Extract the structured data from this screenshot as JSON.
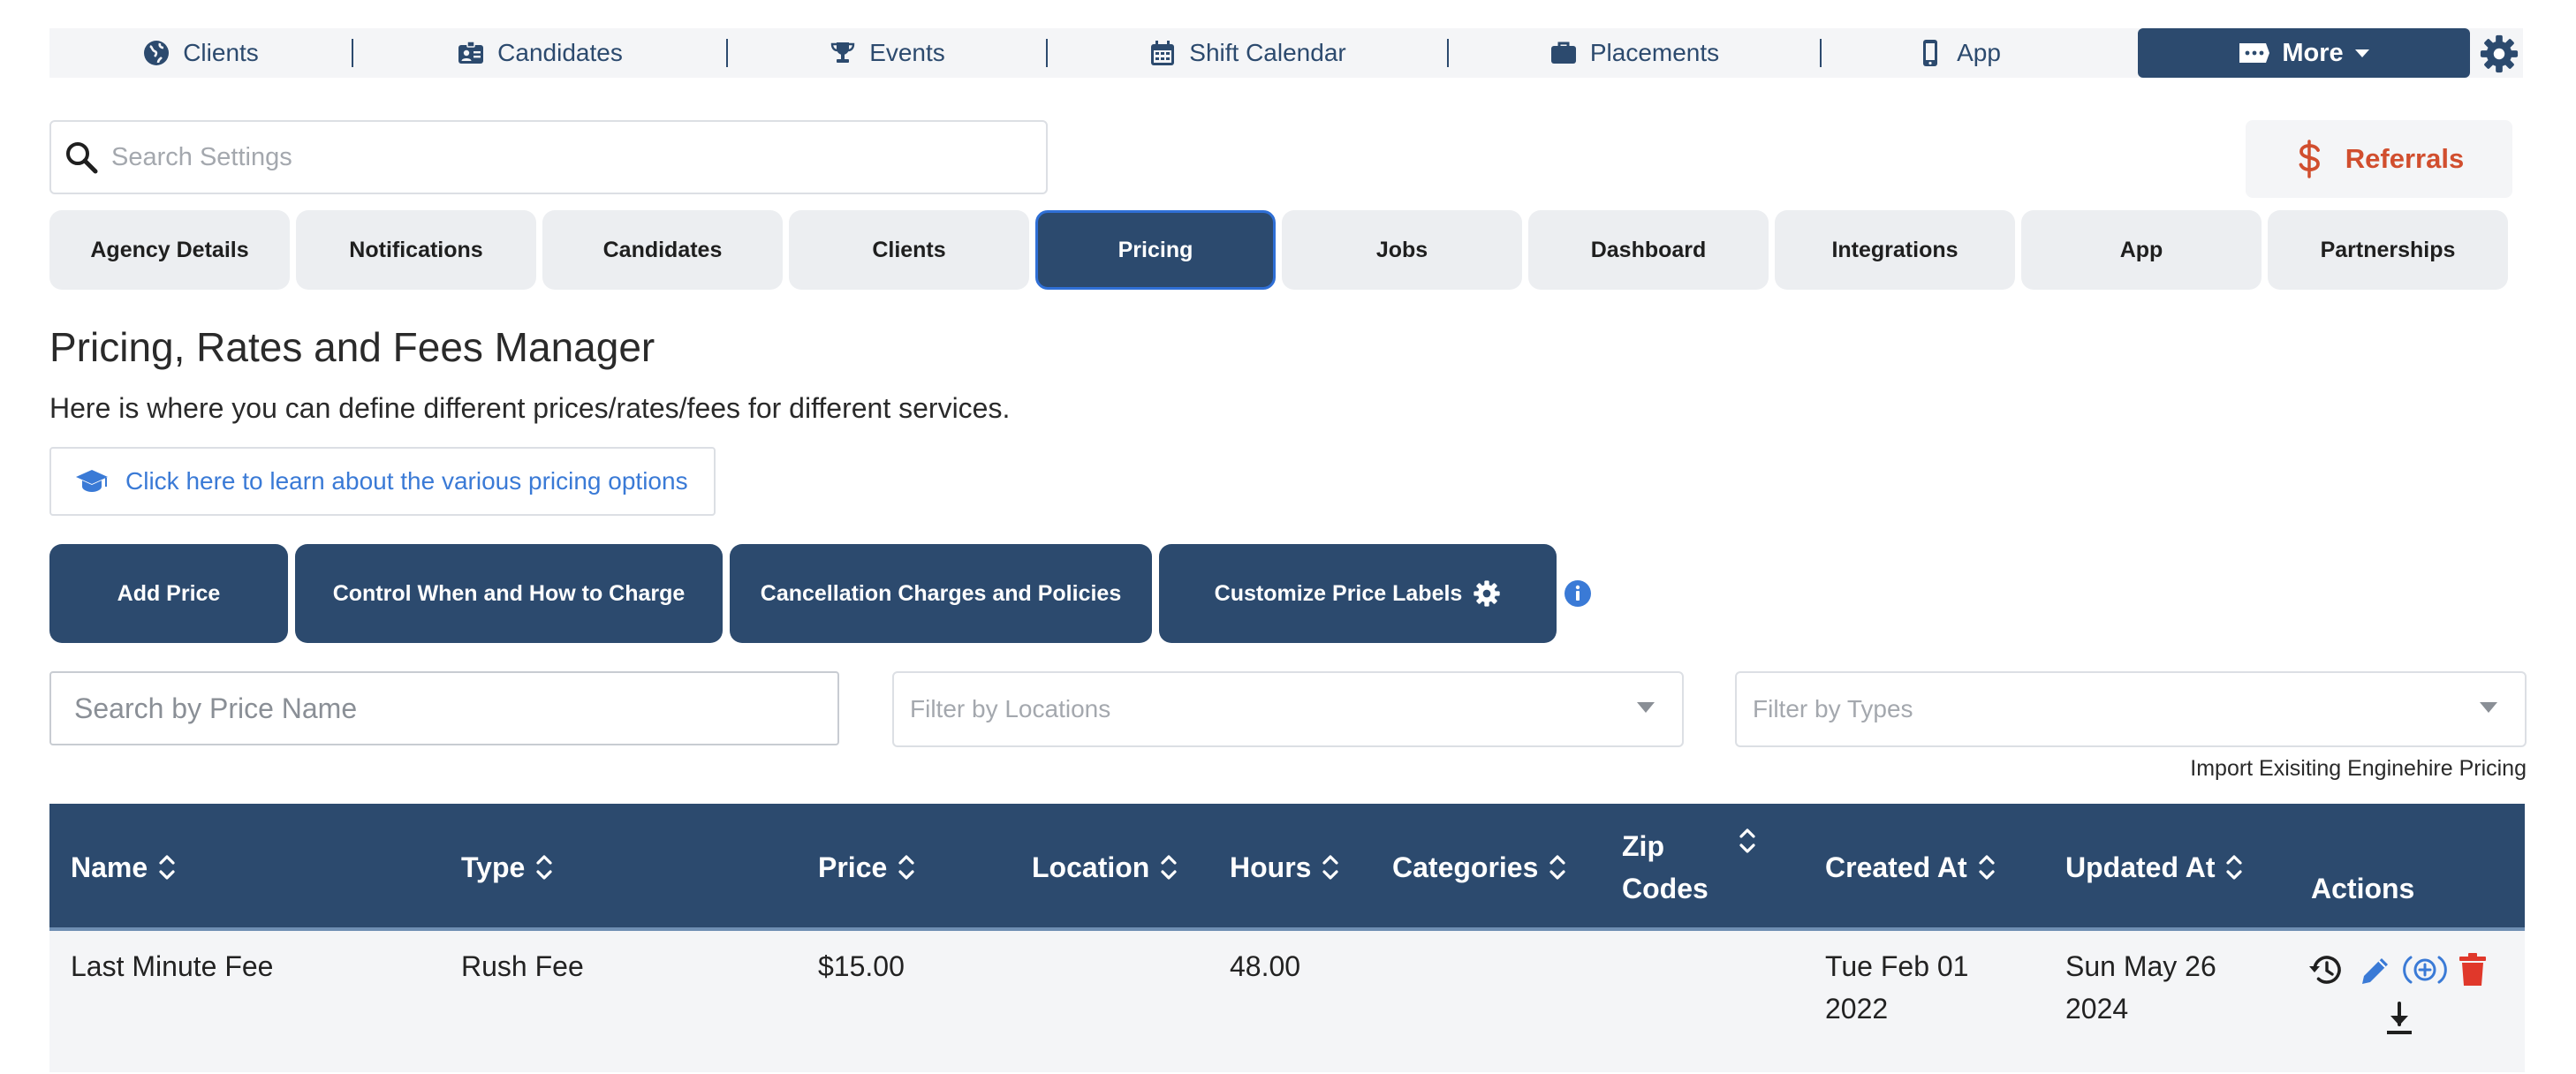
{
  "topnav": {
    "items": [
      {
        "label": "Clients",
        "icon": "globe-icon"
      },
      {
        "label": "Candidates",
        "icon": "id-card-icon"
      },
      {
        "label": "Events",
        "icon": "trophy-icon"
      },
      {
        "label": "Shift Calendar",
        "icon": "calendar-icon"
      },
      {
        "label": "Placements",
        "icon": "briefcase-icon"
      },
      {
        "label": "App",
        "icon": "mobile-icon"
      }
    ],
    "more_label": "More"
  },
  "settings_search": {
    "placeholder": "Search Settings"
  },
  "referrals": {
    "label": "Referrals"
  },
  "tabs": [
    {
      "label": "Agency Details"
    },
    {
      "label": "Notifications"
    },
    {
      "label": "Candidates"
    },
    {
      "label": "Clients"
    },
    {
      "label": "Pricing"
    },
    {
      "label": "Jobs"
    },
    {
      "label": "Dashboard"
    },
    {
      "label": "Integrations"
    },
    {
      "label": "App"
    },
    {
      "label": "Partnerships"
    }
  ],
  "active_tab": "Pricing",
  "page": {
    "title": "Pricing, Rates and Fees Manager",
    "subtitle": "Here is where you can define different prices/rates/fees for different services.",
    "learn_link": "Click here to learn about the various pricing options"
  },
  "actions": {
    "add_price": "Add Price",
    "control_charge": "Control When and How to Charge",
    "cancellation": "Cancellation Charges and Policies",
    "customize_labels": "Customize Price Labels"
  },
  "filters": {
    "price_search_placeholder": "Search by Price Name",
    "locations_placeholder": "Filter by Locations",
    "types_placeholder": "Filter by Types",
    "import_link": "Import Exisiting Enginehire Pricing"
  },
  "table": {
    "columns": {
      "name": "Name",
      "type": "Type",
      "price": "Price",
      "location": "Location",
      "hours": "Hours",
      "categories": "Categories",
      "zip_line1": "Zip",
      "zip_line2": "Codes",
      "created_at": "Created At",
      "updated_at": "Updated At",
      "actions": "Actions"
    },
    "rows": [
      {
        "name": "Last Minute Fee",
        "type": "Rush Fee",
        "price": "$15.00",
        "location": "",
        "hours": "48.00",
        "categories": "",
        "zip_codes": "",
        "created_line1": "Tue Feb 01",
        "created_line2": "2022",
        "updated_line1": "Sun May 26",
        "updated_line2": "2024"
      }
    ]
  },
  "colors": {
    "navy": "#2c4a6e",
    "link_blue": "#3a7ad6",
    "referral_red": "#d14e2e",
    "delete_red": "#e0382b"
  }
}
